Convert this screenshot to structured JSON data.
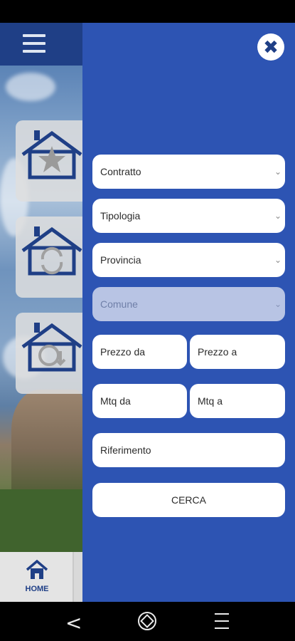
{
  "colors": {
    "drawer": "#2d54b3",
    "header": "#1f3f86",
    "disabled_field": "#b8c4e4",
    "accent_text": "#1f3f86"
  },
  "background_app": {
    "menu_icon": "hamburger-icon",
    "tiles": [
      {
        "icon": "house-star-icon"
      },
      {
        "icon": "house-refresh-icon"
      },
      {
        "icon": "house-euro-icon"
      }
    ],
    "bottom_nav": {
      "home_label": "HOME",
      "home_icon": "home-icon"
    }
  },
  "drawer": {
    "close_icon": "close-icon",
    "selects": {
      "contratto": "Contratto",
      "tipologia": "Tipologia",
      "provincia": "Provincia",
      "comune": "Comune"
    },
    "inputs": {
      "prezzo_da": "Prezzo da",
      "prezzo_a": "Prezzo a",
      "mtq_da": "Mtq da",
      "mtq_a": "Mtq a",
      "riferimento": "Riferimento"
    },
    "search_label": "CERCA"
  },
  "system_nav": {
    "back": "<",
    "home_icon": "system-home-icon",
    "recent_icon": "recent-apps-icon"
  }
}
